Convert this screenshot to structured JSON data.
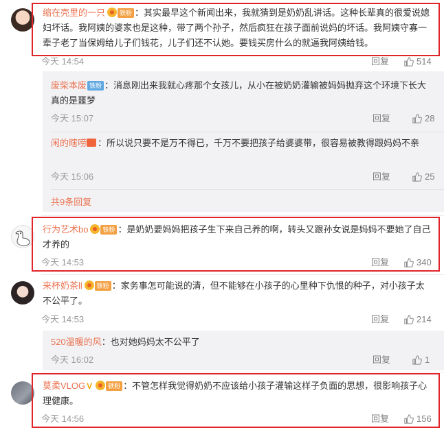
{
  "comments": [
    {
      "user": "缩在壳里的一只",
      "badge": "铁粉",
      "text": "：其实最早这个新闻出来，我就猜到是奶奶乱讲话。这种长辈真的很爱说媳妇坏话。我阿姨的婆家也是这种，带了两个孙子，然后疯狂在孩子面前说妈的坏话。我阿姨守寡一辈子老了当保姆给儿子们钱花，儿子们还不认她。要钱买房什么的就逼我阿姨给钱。",
      "time": "今天 14:54",
      "reply_label": "回复",
      "likes": "514",
      "replies": [
        {
          "user": "废柴本废",
          "badge": "铁粉",
          "text": "：消息刚出来我就心疼那个女孩儿，从小在被奶奶灌输被妈妈抛弃这个环境下长大真的是噩梦",
          "time": "今天 15:07",
          "reply_label": "回复",
          "likes": "28"
        },
        {
          "user": "闲的瞎唠",
          "text": "：所以说只要不是万不得已，千万不要把孩子给婆婆带，很容易被教得跟妈妈不亲",
          "time": "今天 15:06",
          "reply_label": "回复",
          "likes": "25"
        }
      ],
      "more_replies": "共9条回复"
    },
    {
      "user": "行为艺术bo",
      "badge": "铁粉",
      "text": "：是奶奶要妈妈把孩子生下来自己养的啊，转头又跟孙女说是妈妈不要她了自己才养的",
      "time": "今天 14:53",
      "reply_label": "回复",
      "likes": "340"
    },
    {
      "user": "来杯奶茶ll",
      "badge": "铁粉",
      "text": "：家务事怎可能说的清，但不能够在小孩子的心里种下仇恨的种子，对小孩子太不公平了。",
      "time": "今天 14:53",
      "reply_label": "回复",
      "likes": "214",
      "replies": [
        {
          "user": "520温暖的风",
          "text": "：也对她妈妈太不公平了",
          "time": "今天 16:02",
          "reply_label": "回复",
          "likes": "1"
        }
      ]
    },
    {
      "user": "莫柔VLOG",
      "verified": "V",
      "badge": "铁粉",
      "text": "：不管怎样我觉得奶奶不应该给小孩子灌输这样子负面的思想，很影响孩子心理健康。",
      "time": "今天 14:56",
      "reply_label": "回复",
      "likes": "156"
    }
  ],
  "colors": {
    "username": "#eb7350",
    "highlight_box": "#e0242a",
    "reply_bg": "#f2f2f5",
    "meta": "#999999"
  }
}
